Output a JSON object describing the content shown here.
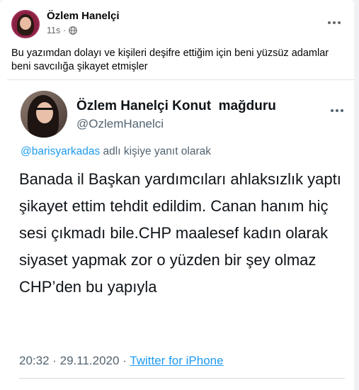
{
  "post": {
    "author": "Özlem Hanelçi",
    "time": "11s",
    "dot": "·",
    "privacy_icon": "globe-icon",
    "caption": "Bu yazımdan dolayı ve kişileri deşifre ettiğim için beni yüzsüz adamlar beni savcılığa şikayet etmişler"
  },
  "tweet": {
    "name": "Özlem Hanelçi Konut  mağduru",
    "handle": "@OzlemHanelci",
    "reply_mention": "@barisyarkadas",
    "reply_suffix": " adlı kişiye yanıt olarak",
    "body": "Banada il Başkan yardımcıları ahlaksızlık yaptı şikayet ettim tehdit edildim. Canan hanım hiç sesi çıkmadı bile.CHP maalesef kadın olarak siyaset yapmak zor o yüzden bir şey olmaz CHP’den bu yapıyla",
    "timestamp": "20:32 · 29.11.2020 · ",
    "source": "Twitter for iPhone"
  },
  "colors": {
    "link_blue": "#1d9bf0",
    "muted_gray": "#536471",
    "fb_gray": "#65676b"
  }
}
